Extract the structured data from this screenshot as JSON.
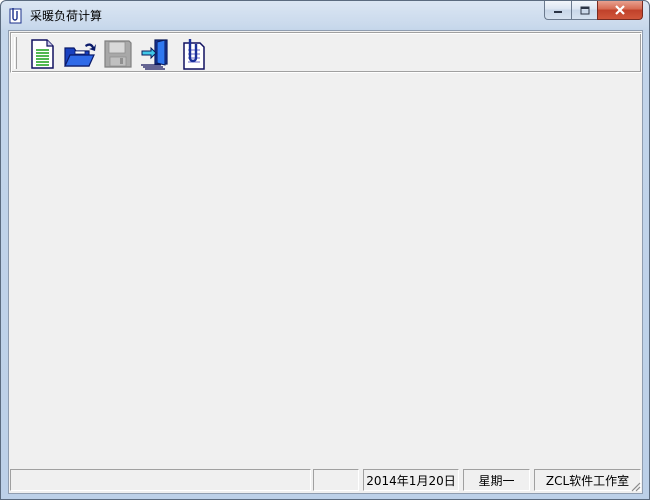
{
  "window": {
    "title": "采暖负荷计算",
    "app_icon": "document-clip-icon",
    "controls": [
      "minimize-icon",
      "maximize-icon",
      "close-icon"
    ]
  },
  "toolbar": {
    "buttons": [
      {
        "name": "new",
        "icon": "new-document-icon",
        "enabled": true
      },
      {
        "name": "open",
        "icon": "open-folder-icon",
        "enabled": true
      },
      {
        "name": "save",
        "icon": "save-disk-icon",
        "enabled": false
      },
      {
        "name": "exit",
        "icon": "exit-door-icon",
        "enabled": true
      },
      {
        "name": "about",
        "icon": "document-clip-icon",
        "enabled": true
      }
    ]
  },
  "statusbar": {
    "panel1": "",
    "panel2": "",
    "date": "2014年1月20日",
    "weekday": "星期一",
    "company": "ZCL软件工作室"
  }
}
